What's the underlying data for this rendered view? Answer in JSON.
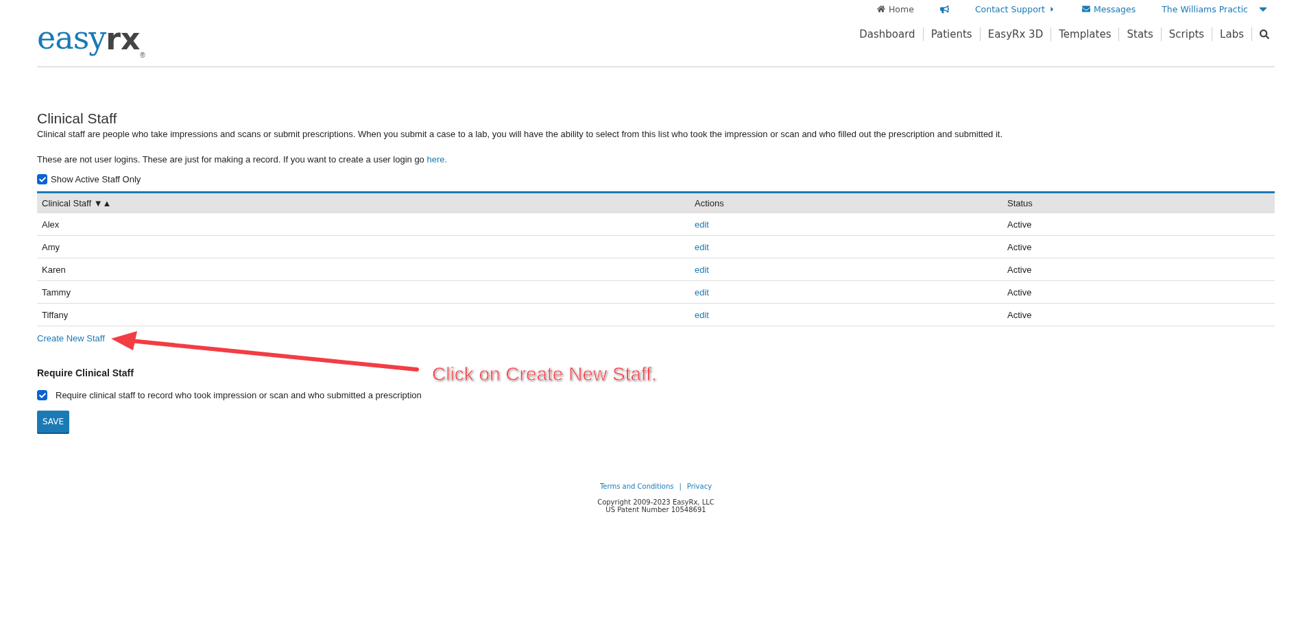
{
  "logo": {
    "main": "easy",
    "accent": "rx",
    "mark": "®"
  },
  "top_links": [
    {
      "kind": "home",
      "label": "Home"
    },
    {
      "kind": "announce"
    },
    {
      "kind": "support",
      "label": "Contact Support"
    },
    {
      "kind": "messages",
      "label": "Messages"
    },
    {
      "kind": "account",
      "label": "The Williams Practic"
    }
  ],
  "nav": [
    "Dashboard",
    "Patients",
    "EasyRx 3D",
    "Templates",
    "Stats",
    "Scripts",
    "Labs"
  ],
  "page": {
    "title": "Clinical Staff",
    "description": "Clinical staff are people who take impressions and scans or submit prescriptions. When you submit a case to a lab, you will have the ability to select from this list who took the impression or scan and who filled out the prescription and submitted it.",
    "note": "These are not user logins. These are just for making a record. If you want to create a user login go",
    "note_link": "here."
  },
  "filter": {
    "label": "Show Active Staff Only",
    "checked": true
  },
  "table": {
    "columns": [
      "Clinical Staff ▼▲",
      "Actions",
      "Status"
    ],
    "rows": [
      {
        "name": "Alex",
        "action": "edit",
        "status": "Active"
      },
      {
        "name": "Amy",
        "action": "edit",
        "status": "Active"
      },
      {
        "name": "Karen",
        "action": "edit",
        "status": "Active"
      },
      {
        "name": "Tammy",
        "action": "edit",
        "status": "Active"
      },
      {
        "name": "Tiffany",
        "action": "edit",
        "status": "Active"
      }
    ]
  },
  "create_link": "Create New Staff",
  "require": {
    "heading": "Require Clinical Staff",
    "label": "Require clinical staff to record who took impression or scan and who submitted a prescription",
    "checked": true
  },
  "save_button": "SAVE",
  "annotation": "Click on Create New Staff.",
  "footer": {
    "links": [
      "Terms and Conditions",
      "Privacy"
    ],
    "separator": "|",
    "copyright": "Copyright 2009-2023 EasyRx, LLC",
    "patent": "US Patent Number 10548691"
  }
}
